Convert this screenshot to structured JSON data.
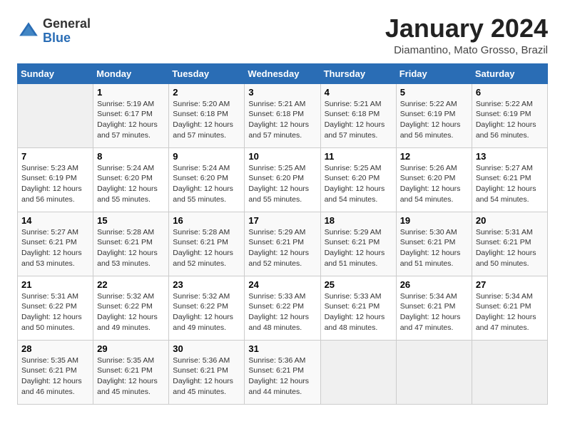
{
  "header": {
    "logo_general": "General",
    "logo_blue": "Blue",
    "month_year": "January 2024",
    "location": "Diamantino, Mato Grosso, Brazil"
  },
  "weekdays": [
    "Sunday",
    "Monday",
    "Tuesday",
    "Wednesday",
    "Thursday",
    "Friday",
    "Saturday"
  ],
  "weeks": [
    [
      {
        "day": "",
        "sunrise": "",
        "sunset": "",
        "daylight": ""
      },
      {
        "day": "1",
        "sunrise": "Sunrise: 5:19 AM",
        "sunset": "Sunset: 6:17 PM",
        "daylight": "Daylight: 12 hours and 57 minutes."
      },
      {
        "day": "2",
        "sunrise": "Sunrise: 5:20 AM",
        "sunset": "Sunset: 6:18 PM",
        "daylight": "Daylight: 12 hours and 57 minutes."
      },
      {
        "day": "3",
        "sunrise": "Sunrise: 5:21 AM",
        "sunset": "Sunset: 6:18 PM",
        "daylight": "Daylight: 12 hours and 57 minutes."
      },
      {
        "day": "4",
        "sunrise": "Sunrise: 5:21 AM",
        "sunset": "Sunset: 6:18 PM",
        "daylight": "Daylight: 12 hours and 57 minutes."
      },
      {
        "day": "5",
        "sunrise": "Sunrise: 5:22 AM",
        "sunset": "Sunset: 6:19 PM",
        "daylight": "Daylight: 12 hours and 56 minutes."
      },
      {
        "day": "6",
        "sunrise": "Sunrise: 5:22 AM",
        "sunset": "Sunset: 6:19 PM",
        "daylight": "Daylight: 12 hours and 56 minutes."
      }
    ],
    [
      {
        "day": "7",
        "sunrise": "Sunrise: 5:23 AM",
        "sunset": "Sunset: 6:19 PM",
        "daylight": "Daylight: 12 hours and 56 minutes."
      },
      {
        "day": "8",
        "sunrise": "Sunrise: 5:24 AM",
        "sunset": "Sunset: 6:20 PM",
        "daylight": "Daylight: 12 hours and 55 minutes."
      },
      {
        "day": "9",
        "sunrise": "Sunrise: 5:24 AM",
        "sunset": "Sunset: 6:20 PM",
        "daylight": "Daylight: 12 hours and 55 minutes."
      },
      {
        "day": "10",
        "sunrise": "Sunrise: 5:25 AM",
        "sunset": "Sunset: 6:20 PM",
        "daylight": "Daylight: 12 hours and 55 minutes."
      },
      {
        "day": "11",
        "sunrise": "Sunrise: 5:25 AM",
        "sunset": "Sunset: 6:20 PM",
        "daylight": "Daylight: 12 hours and 54 minutes."
      },
      {
        "day": "12",
        "sunrise": "Sunrise: 5:26 AM",
        "sunset": "Sunset: 6:20 PM",
        "daylight": "Daylight: 12 hours and 54 minutes."
      },
      {
        "day": "13",
        "sunrise": "Sunrise: 5:27 AM",
        "sunset": "Sunset: 6:21 PM",
        "daylight": "Daylight: 12 hours and 54 minutes."
      }
    ],
    [
      {
        "day": "14",
        "sunrise": "Sunrise: 5:27 AM",
        "sunset": "Sunset: 6:21 PM",
        "daylight": "Daylight: 12 hours and 53 minutes."
      },
      {
        "day": "15",
        "sunrise": "Sunrise: 5:28 AM",
        "sunset": "Sunset: 6:21 PM",
        "daylight": "Daylight: 12 hours and 53 minutes."
      },
      {
        "day": "16",
        "sunrise": "Sunrise: 5:28 AM",
        "sunset": "Sunset: 6:21 PM",
        "daylight": "Daylight: 12 hours and 52 minutes."
      },
      {
        "day": "17",
        "sunrise": "Sunrise: 5:29 AM",
        "sunset": "Sunset: 6:21 PM",
        "daylight": "Daylight: 12 hours and 52 minutes."
      },
      {
        "day": "18",
        "sunrise": "Sunrise: 5:29 AM",
        "sunset": "Sunset: 6:21 PM",
        "daylight": "Daylight: 12 hours and 51 minutes."
      },
      {
        "day": "19",
        "sunrise": "Sunrise: 5:30 AM",
        "sunset": "Sunset: 6:21 PM",
        "daylight": "Daylight: 12 hours and 51 minutes."
      },
      {
        "day": "20",
        "sunrise": "Sunrise: 5:31 AM",
        "sunset": "Sunset: 6:21 PM",
        "daylight": "Daylight: 12 hours and 50 minutes."
      }
    ],
    [
      {
        "day": "21",
        "sunrise": "Sunrise: 5:31 AM",
        "sunset": "Sunset: 6:22 PM",
        "daylight": "Daylight: 12 hours and 50 minutes."
      },
      {
        "day": "22",
        "sunrise": "Sunrise: 5:32 AM",
        "sunset": "Sunset: 6:22 PM",
        "daylight": "Daylight: 12 hours and 49 minutes."
      },
      {
        "day": "23",
        "sunrise": "Sunrise: 5:32 AM",
        "sunset": "Sunset: 6:22 PM",
        "daylight": "Daylight: 12 hours and 49 minutes."
      },
      {
        "day": "24",
        "sunrise": "Sunrise: 5:33 AM",
        "sunset": "Sunset: 6:22 PM",
        "daylight": "Daylight: 12 hours and 48 minutes."
      },
      {
        "day": "25",
        "sunrise": "Sunrise: 5:33 AM",
        "sunset": "Sunset: 6:21 PM",
        "daylight": "Daylight: 12 hours and 48 minutes."
      },
      {
        "day": "26",
        "sunrise": "Sunrise: 5:34 AM",
        "sunset": "Sunset: 6:21 PM",
        "daylight": "Daylight: 12 hours and 47 minutes."
      },
      {
        "day": "27",
        "sunrise": "Sunrise: 5:34 AM",
        "sunset": "Sunset: 6:21 PM",
        "daylight": "Daylight: 12 hours and 47 minutes."
      }
    ],
    [
      {
        "day": "28",
        "sunrise": "Sunrise: 5:35 AM",
        "sunset": "Sunset: 6:21 PM",
        "daylight": "Daylight: 12 hours and 46 minutes."
      },
      {
        "day": "29",
        "sunrise": "Sunrise: 5:35 AM",
        "sunset": "Sunset: 6:21 PM",
        "daylight": "Daylight: 12 hours and 45 minutes."
      },
      {
        "day": "30",
        "sunrise": "Sunrise: 5:36 AM",
        "sunset": "Sunset: 6:21 PM",
        "daylight": "Daylight: 12 hours and 45 minutes."
      },
      {
        "day": "31",
        "sunrise": "Sunrise: 5:36 AM",
        "sunset": "Sunset: 6:21 PM",
        "daylight": "Daylight: 12 hours and 44 minutes."
      },
      {
        "day": "",
        "sunrise": "",
        "sunset": "",
        "daylight": ""
      },
      {
        "day": "",
        "sunrise": "",
        "sunset": "",
        "daylight": ""
      },
      {
        "day": "",
        "sunrise": "",
        "sunset": "",
        "daylight": ""
      }
    ]
  ]
}
